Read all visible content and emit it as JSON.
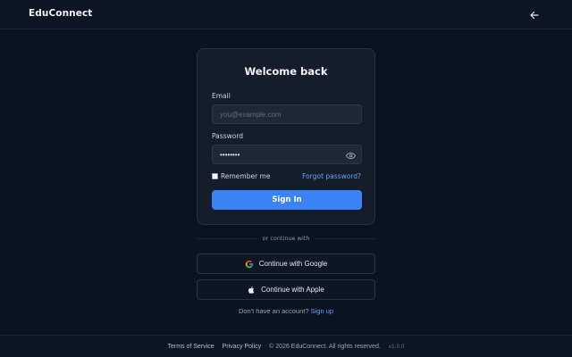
{
  "header": {
    "brand": "EduConnect",
    "back_icon": "arrow-left-icon"
  },
  "login_card": {
    "title": "Welcome back",
    "email_label": "Email",
    "email_placeholder": "you@example.com",
    "password_label": "Password",
    "password_value": "password",
    "password_toggle_icon": "eye-icon",
    "remember_label": "Remember me",
    "remember_checked": false,
    "forgot_link": "Forgot password?",
    "submit_label": "Sign In"
  },
  "alternatives": {
    "divider_text": "or continue with",
    "google_label": "Continue with Google",
    "google_icon": "google-icon",
    "apple_label": "Continue with Apple",
    "apple_icon": "apple-icon"
  },
  "signup": {
    "prompt": "Don't have an account?",
    "link": "Sign up"
  },
  "footer": {
    "terms": "Terms of Service",
    "privacy": "Privacy Policy",
    "copyright": "© 2026 EduConnect. All rights reserved.",
    "version": "v1.0.0"
  },
  "colors": {
    "background": "#0b1220",
    "card": "#151d2b",
    "accent": "#3b82f6",
    "link": "#60a5fa"
  }
}
